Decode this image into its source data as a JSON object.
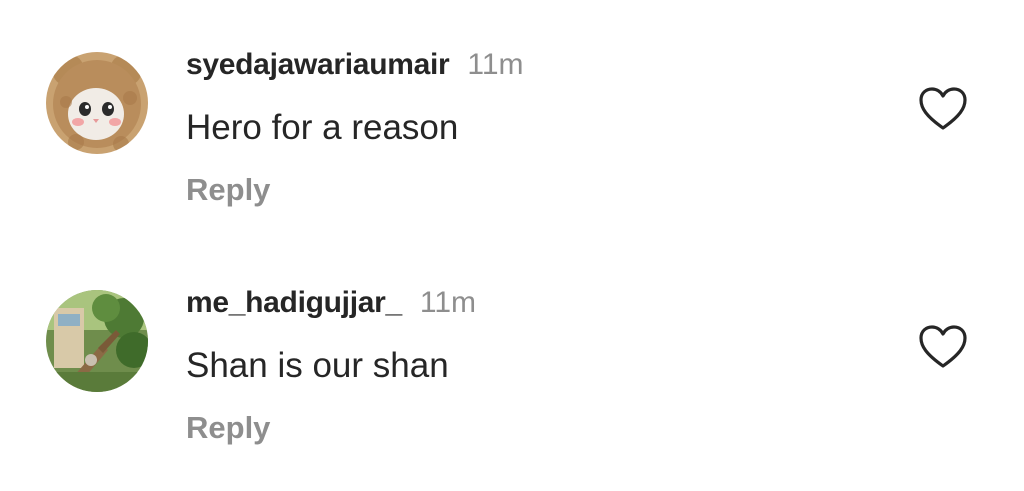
{
  "comments": [
    {
      "username": "syedajawariaumair",
      "time": "11m",
      "text": "Hero for a reason",
      "reply_label": "Reply",
      "like_icon": "heart-outline-icon",
      "avatar": "avatar-fluffy-cat-in-bear-hood"
    },
    {
      "username": "me_hadigujjar_",
      "time": "11m",
      "text": "Shan is our shan",
      "reply_label": "Reply",
      "like_icon": "heart-outline-icon",
      "avatar": "avatar-outdoor-tree-photo"
    }
  ],
  "colors": {
    "primary_text": "#262626",
    "secondary_text": "#8e8e8e",
    "background": "#ffffff",
    "icon_stroke": "#262626"
  }
}
